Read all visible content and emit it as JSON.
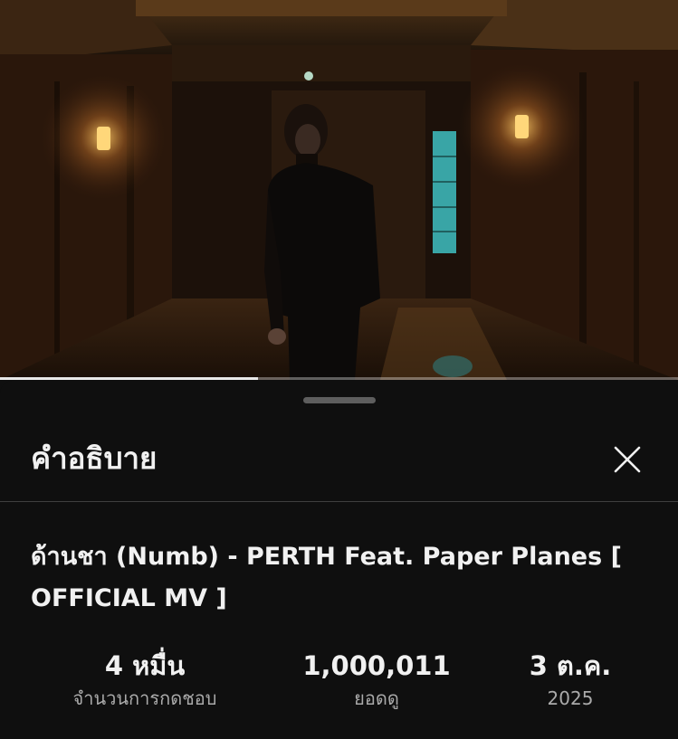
{
  "video": {
    "progress_fraction": 0.38
  },
  "sheet": {
    "title": "คำอธิบาย",
    "video_title": "ด้านชา (Numb) - PERTH Feat. Paper Planes [ OFFICIAL MV ]"
  },
  "stats": {
    "likes": {
      "value": "4 หมื่น",
      "label": "จำนวนการกดชอบ"
    },
    "views": {
      "value": "1,000,011",
      "label": "ยอดดู"
    },
    "date": {
      "value": "3 ต.ค.",
      "label": "2025"
    }
  },
  "icons": {
    "close": "close-icon"
  },
  "colors": {
    "background": "#0f0f0f",
    "text_primary": "#f1f1f1",
    "text_secondary": "#aaaaaa",
    "divider": "#3f3f3f",
    "handle": "#5e5e5e"
  }
}
